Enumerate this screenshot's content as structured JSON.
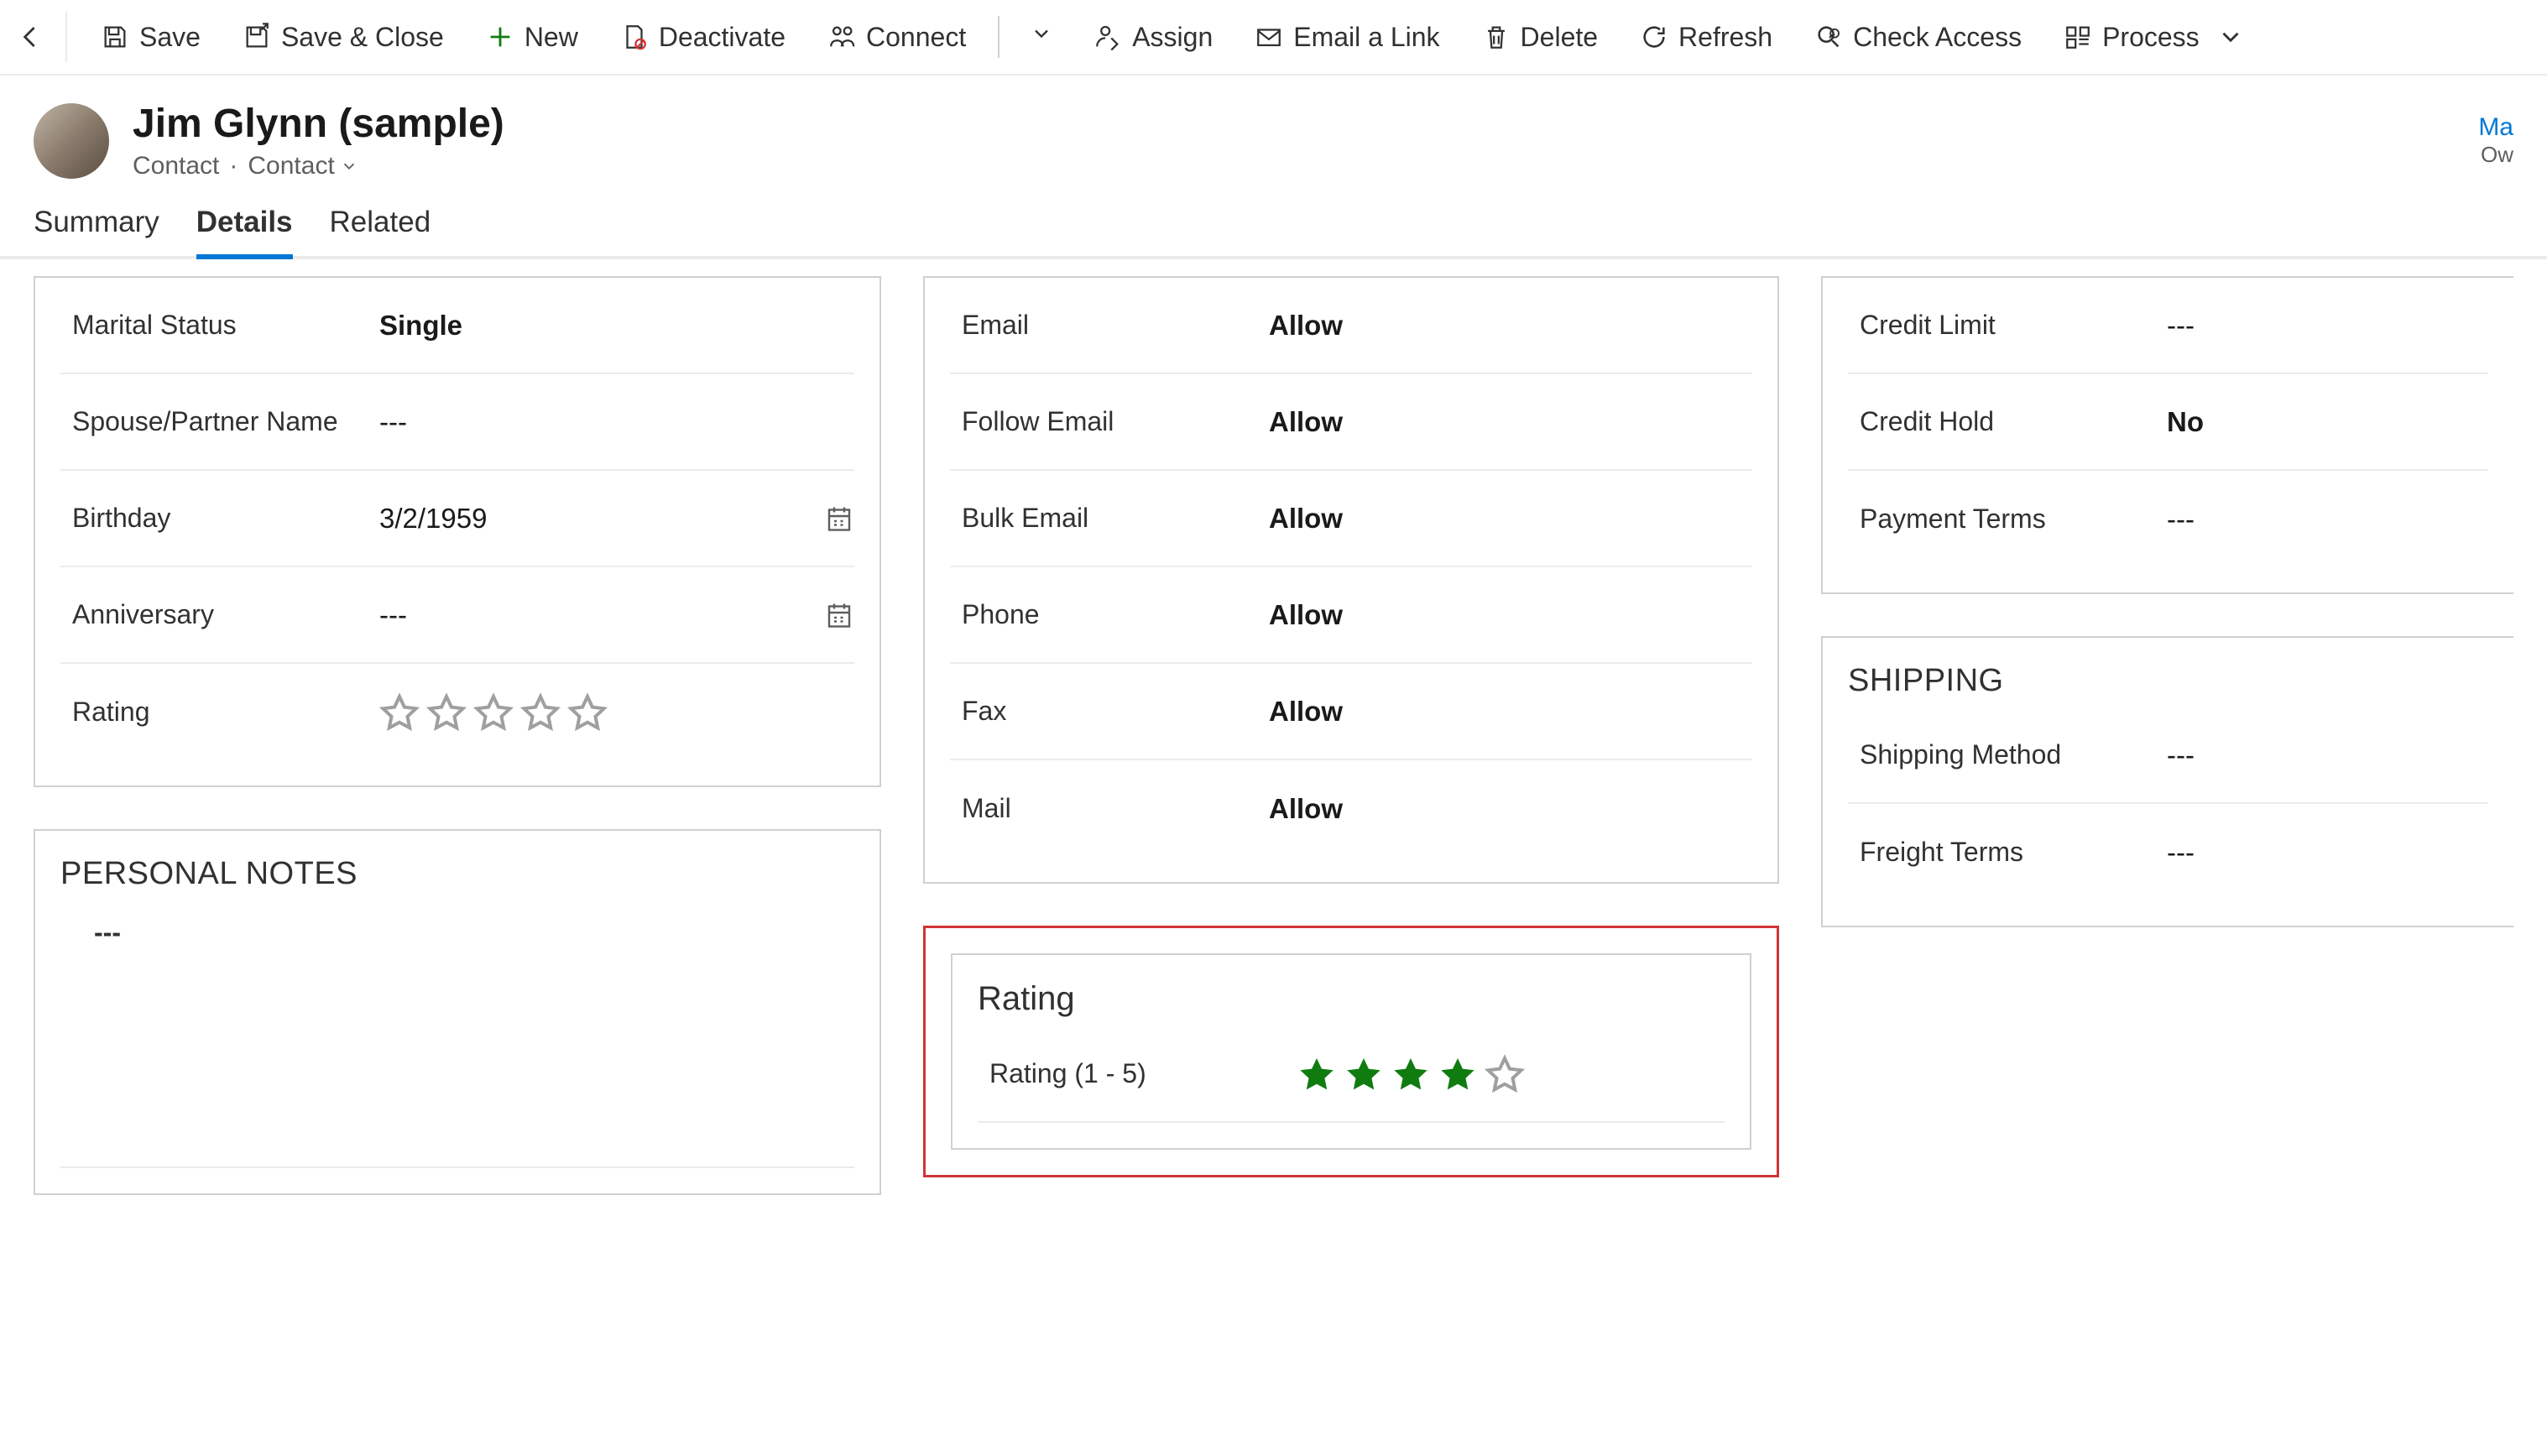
{
  "commands": {
    "save": "Save",
    "save_close": "Save & Close",
    "new": "New",
    "deactivate": "Deactivate",
    "connect": "Connect",
    "assign": "Assign",
    "email_link": "Email a Link",
    "delete": "Delete",
    "refresh": "Refresh",
    "check_access": "Check Access",
    "process": "Process"
  },
  "header": {
    "title": "Jim Glynn (sample)",
    "entity": "Contact",
    "form": "Contact",
    "owner_link": "Ma",
    "owner_sub": "Ow"
  },
  "tabs": {
    "summary": "Summary",
    "details": "Details",
    "related": "Related"
  },
  "personal": {
    "marital_status_label": "Marital Status",
    "marital_status_value": "Single",
    "spouse_label": "Spouse/Partner Name",
    "spouse_value": "---",
    "birthday_label": "Birthday",
    "birthday_value": "3/2/1959",
    "anniversary_label": "Anniversary",
    "anniversary_value": "---",
    "rating_label": "Rating",
    "rating_value": 0
  },
  "notes": {
    "title": "PERSONAL NOTES",
    "value": "---"
  },
  "contact_prefs": {
    "email_label": "Email",
    "email_value": "Allow",
    "follow_label": "Follow Email",
    "follow_value": "Allow",
    "bulk_label": "Bulk Email",
    "bulk_value": "Allow",
    "phone_label": "Phone",
    "phone_value": "Allow",
    "fax_label": "Fax",
    "fax_value": "Allow",
    "mail_label": "Mail",
    "mail_value": "Allow"
  },
  "rating_section": {
    "title": "Rating",
    "label": "Rating (1 - 5)",
    "value": 4
  },
  "billing": {
    "credit_limit_label": "Credit Limit",
    "credit_limit_value": "---",
    "credit_hold_label": "Credit Hold",
    "credit_hold_value": "No",
    "payment_terms_label": "Payment Terms",
    "payment_terms_value": "---"
  },
  "shipping": {
    "title": "SHIPPING",
    "method_label": "Shipping Method",
    "method_value": "---",
    "freight_label": "Freight Terms",
    "freight_value": "---"
  }
}
